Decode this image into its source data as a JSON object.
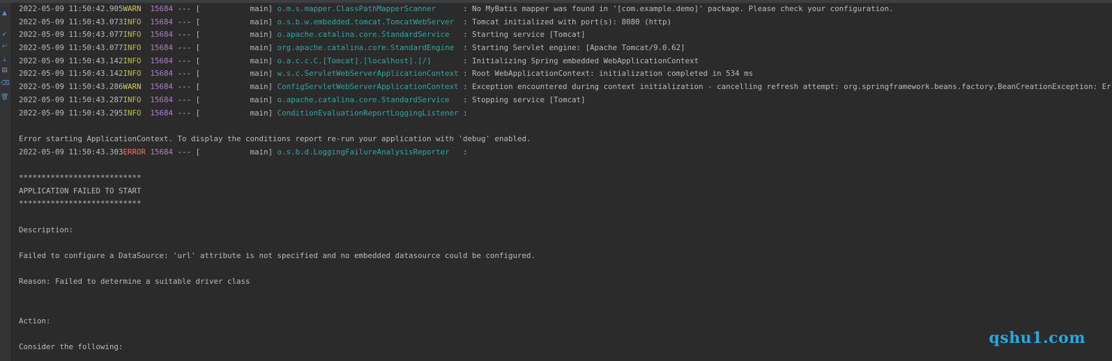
{
  "gutter": {
    "icons": [
      {
        "name": "up-arrow-icon",
        "glyph": "▲",
        "color": "#5c8fc4"
      },
      {
        "name": "down-arrow-icon",
        "glyph": "↙",
        "color": "#5c8fc4"
      },
      {
        "name": "soft-wrap-icon",
        "glyph": "↩",
        "color": "#5c8fc4"
      },
      {
        "name": "scroll-to-end-icon",
        "glyph": "⇣",
        "color": "#5c8fc4"
      },
      {
        "name": "print-icon",
        "glyph": "▤",
        "color": "#b07fc8"
      },
      {
        "name": "clear-all-icon",
        "glyph": "⌫",
        "color": "#5c8fc4"
      },
      {
        "name": "trash-icon",
        "glyph": "🗑",
        "color": "#5c8fc4"
      }
    ]
  },
  "log": [
    {
      "type": "log",
      "ts": "2022-05-09 11:50:42.905",
      "level": "WARN ",
      "level_class": "warn",
      "pid": "15684",
      "sep": " --- [",
      "thread": "           main] ",
      "logger": "o.m.s.mapper.ClassPathMapperScanner     ",
      "msg": " : No MyBatis mapper was found in '[com.example.demo]' package. Please check your configuration."
    },
    {
      "type": "log",
      "ts": "2022-05-09 11:50:43.073",
      "level": "INFO ",
      "level_class": "info",
      "pid": "15684",
      "sep": " --- [",
      "thread": "           main] ",
      "logger": "o.s.b.w.embedded.tomcat.TomcatWebServer ",
      "msg": " : Tomcat initialized with port(s): 8080 (http)"
    },
    {
      "type": "log",
      "ts": "2022-05-09 11:50:43.077",
      "level": "INFO ",
      "level_class": "info",
      "pid": "15684",
      "sep": " --- [",
      "thread": "           main] ",
      "logger": "o.apache.catalina.core.StandardService  ",
      "msg": " : Starting service [Tomcat]"
    },
    {
      "type": "log",
      "ts": "2022-05-09 11:50:43.077",
      "level": "INFO ",
      "level_class": "info",
      "pid": "15684",
      "sep": " --- [",
      "thread": "           main] ",
      "logger": "org.apache.catalina.core.StandardEngine ",
      "msg": " : Starting Servlet engine: [Apache Tomcat/9.0.62]"
    },
    {
      "type": "log",
      "ts": "2022-05-09 11:50:43.142",
      "level": "INFO ",
      "level_class": "info",
      "pid": "15684",
      "sep": " --- [",
      "thread": "           main] ",
      "logger": "o.a.c.c.C.[Tomcat].[localhost].[/]      ",
      "msg": " : Initializing Spring embedded WebApplicationContext"
    },
    {
      "type": "log",
      "ts": "2022-05-09 11:50:43.142",
      "level": "INFO ",
      "level_class": "info",
      "pid": "15684",
      "sep": " --- [",
      "thread": "           main] ",
      "logger": "w.s.c.ServletWebServerApplicationContext",
      "msg": " : Root WebApplicationContext: initialization completed in 534 ms"
    },
    {
      "type": "log",
      "ts": "2022-05-09 11:50:43.286",
      "level": "WARN ",
      "level_class": "warn",
      "pid": "15684",
      "sep": " --- [",
      "thread": "           main] ",
      "logger": "ConfigServletWebServerApplicationContext",
      "msg": " : Exception encountered during context initialization - cancelling refresh attempt: org.springframework.beans.factory.BeanCreationException: Error creating bean w"
    },
    {
      "type": "log",
      "ts": "2022-05-09 11:50:43.287",
      "level": "INFO ",
      "level_class": "info",
      "pid": "15684",
      "sep": " --- [",
      "thread": "           main] ",
      "logger": "o.apache.catalina.core.StandardService  ",
      "msg": " : Stopping service [Tomcat]"
    },
    {
      "type": "log",
      "ts": "2022-05-09 11:50:43.295",
      "level": "INFO ",
      "level_class": "info",
      "pid": "15684",
      "sep": " --- [",
      "thread": "           main] ",
      "logger": "ConditionEvaluationReportLoggingListener",
      "msg": " : "
    },
    {
      "type": "text",
      "text": ""
    },
    {
      "type": "text",
      "text": "Error starting ApplicationContext. To display the conditions report re-run your application with 'debug' enabled."
    },
    {
      "type": "log",
      "ts": "2022-05-09 11:50:43.303",
      "level": "ERROR",
      "level_class": "error",
      "pid": "15684",
      "sep": " --- [",
      "thread": "           main] ",
      "logger": "o.s.b.d.LoggingFailureAnalysisReporter  ",
      "msg": " : "
    },
    {
      "type": "text",
      "text": ""
    },
    {
      "type": "text",
      "text": "***************************"
    },
    {
      "type": "text",
      "text": "APPLICATION FAILED TO START"
    },
    {
      "type": "text",
      "text": "***************************"
    },
    {
      "type": "text",
      "text": ""
    },
    {
      "type": "text",
      "text": "Description:"
    },
    {
      "type": "text",
      "text": ""
    },
    {
      "type": "text",
      "text": "Failed to configure a DataSource: 'url' attribute is not specified and no embedded datasource could be configured."
    },
    {
      "type": "text",
      "text": ""
    },
    {
      "type": "text",
      "text": "Reason: Failed to determine a suitable driver class"
    },
    {
      "type": "text",
      "text": ""
    },
    {
      "type": "text",
      "text": ""
    },
    {
      "type": "text",
      "text": "Action:"
    },
    {
      "type": "text",
      "text": ""
    },
    {
      "type": "text",
      "text": "Consider the following:"
    }
  ],
  "watermark": "qshu1.com",
  "colors": {
    "background": "#2b2b2b",
    "warn": "#d8c96a",
    "info": "#b9c04a",
    "error": "#ff6b68",
    "pid": "#b07fc8",
    "logger": "#2fa6a2",
    "text": "#bbbbbb",
    "watermark": "#29a7df"
  }
}
